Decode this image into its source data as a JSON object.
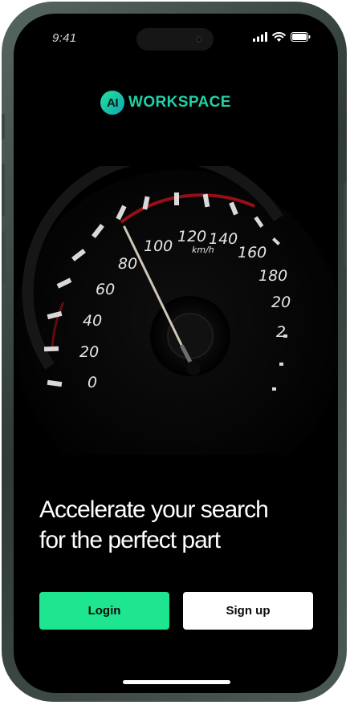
{
  "status_bar": {
    "time": "9:41"
  },
  "brand": {
    "mark": "AI",
    "name": "WORKSPACE",
    "color": "#1fd1a8"
  },
  "gauge": {
    "unit": "km/h",
    "labels": [
      "0",
      "20",
      "40",
      "60",
      "80",
      "100",
      "120",
      "140",
      "160",
      "180",
      "20",
      "2"
    ]
  },
  "hero": {
    "line1": "Accelerate your search",
    "line2": "for the perfect part"
  },
  "actions": {
    "login_label": "Login",
    "signup_label": "Sign up",
    "login_color": "#1ee58f"
  }
}
